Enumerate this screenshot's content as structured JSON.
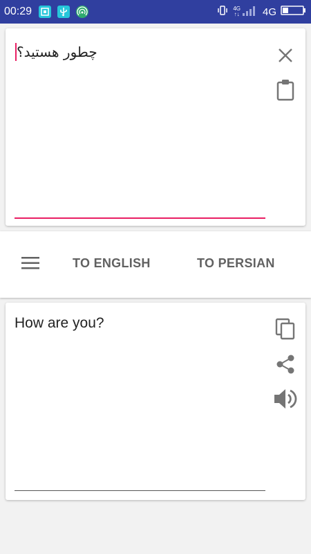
{
  "status_bar": {
    "time": "00:29",
    "network_label": "4G",
    "signal_small_top": "4G",
    "signal_small_bottom": "↑↓",
    "bar_color": "#303f9f",
    "notification_icons": [
      "screenshot-icon",
      "usb-icon",
      "hotspot-icon"
    ]
  },
  "input": {
    "text": "چطور هستید؟",
    "accent_color": "#e91e63",
    "actions": [
      "close-icon",
      "clipboard-icon"
    ]
  },
  "toolbar": {
    "menu_icon": "hamburger-menu-icon",
    "to_english_label": "TO ENGLISH",
    "to_persian_label": "TO PERSIAN"
  },
  "output": {
    "text": "How are you?",
    "actions": [
      "copy-icon",
      "share-icon",
      "speaker-icon"
    ]
  }
}
